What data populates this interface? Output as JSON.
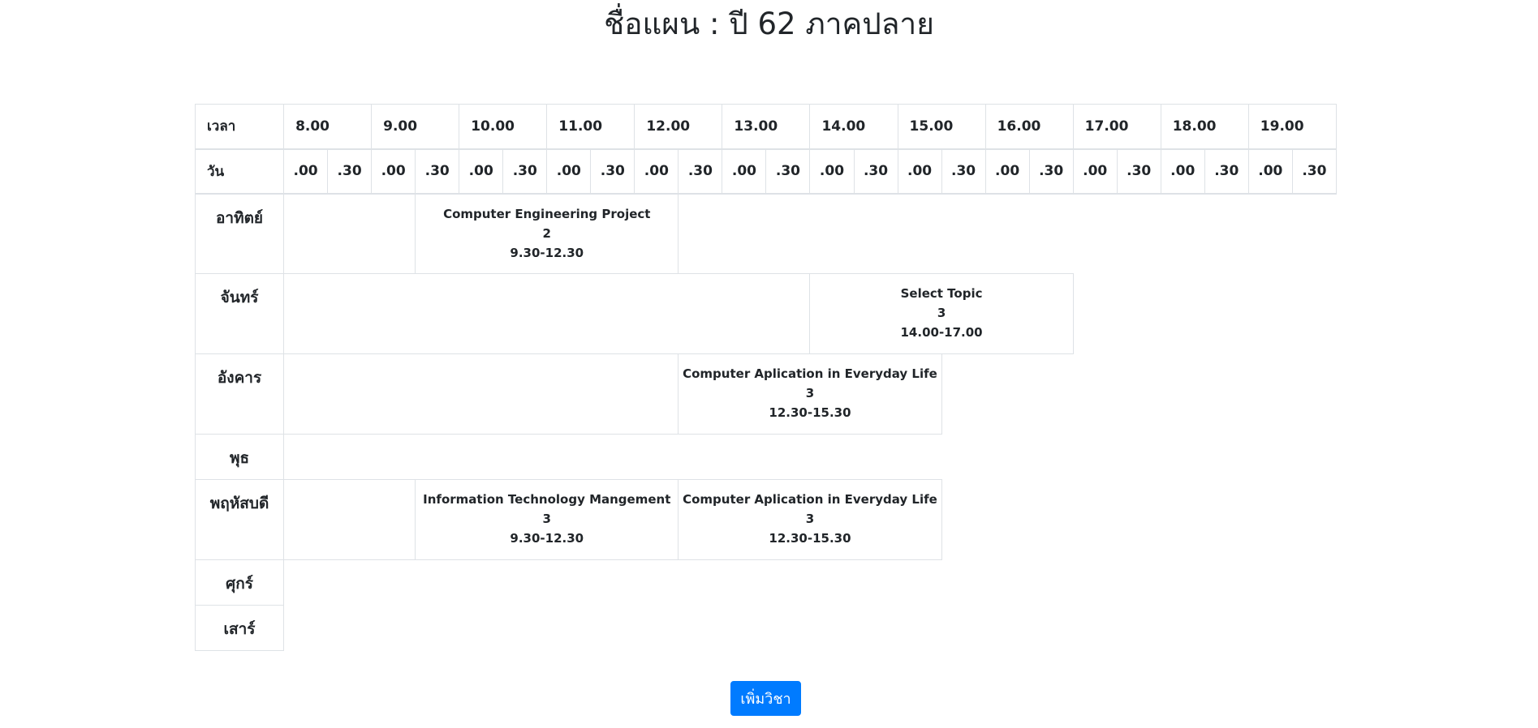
{
  "page": {
    "title": "ชื่อแผน : ปี 62 ภาคปลาย"
  },
  "table": {
    "time_label": "เวลา",
    "day_label": "วัน",
    "hours": [
      "8.00",
      "9.00",
      "10.00",
      "11.00",
      "12.00",
      "13.00",
      "14.00",
      "15.00",
      "16.00",
      "17.00",
      "18.00",
      "19.00"
    ],
    "half_labels": [
      ".00",
      ".30"
    ],
    "days": [
      "อาทิตย์",
      "จันทร์",
      "อังคาร",
      "พุธ",
      "พฤหัสบดี",
      "ศุกร์",
      "เสาร์"
    ]
  },
  "courses": {
    "sun_1": {
      "name": "Computer Engineering Project",
      "credits": "2",
      "time": "9.30-12.30"
    },
    "mon_1": {
      "name": "Select Topic",
      "credits": "3",
      "time": "14.00-17.00"
    },
    "tue_1": {
      "name": "Computer Aplication in Everyday Life",
      "credits": "3",
      "time": "12.30-15.30"
    },
    "thu_1": {
      "name": "Information Technology Mangement",
      "credits": "3",
      "time": "9.30-12.30"
    },
    "thu_2": {
      "name": "Computer Aplication in Everyday Life",
      "credits": "3",
      "time": "12.30-15.30"
    }
  },
  "actions": {
    "add_label": "เพิ่มวิชา"
  },
  "colors": {
    "primary": "#007bff",
    "border": "#dee2e6",
    "text": "#212529"
  }
}
